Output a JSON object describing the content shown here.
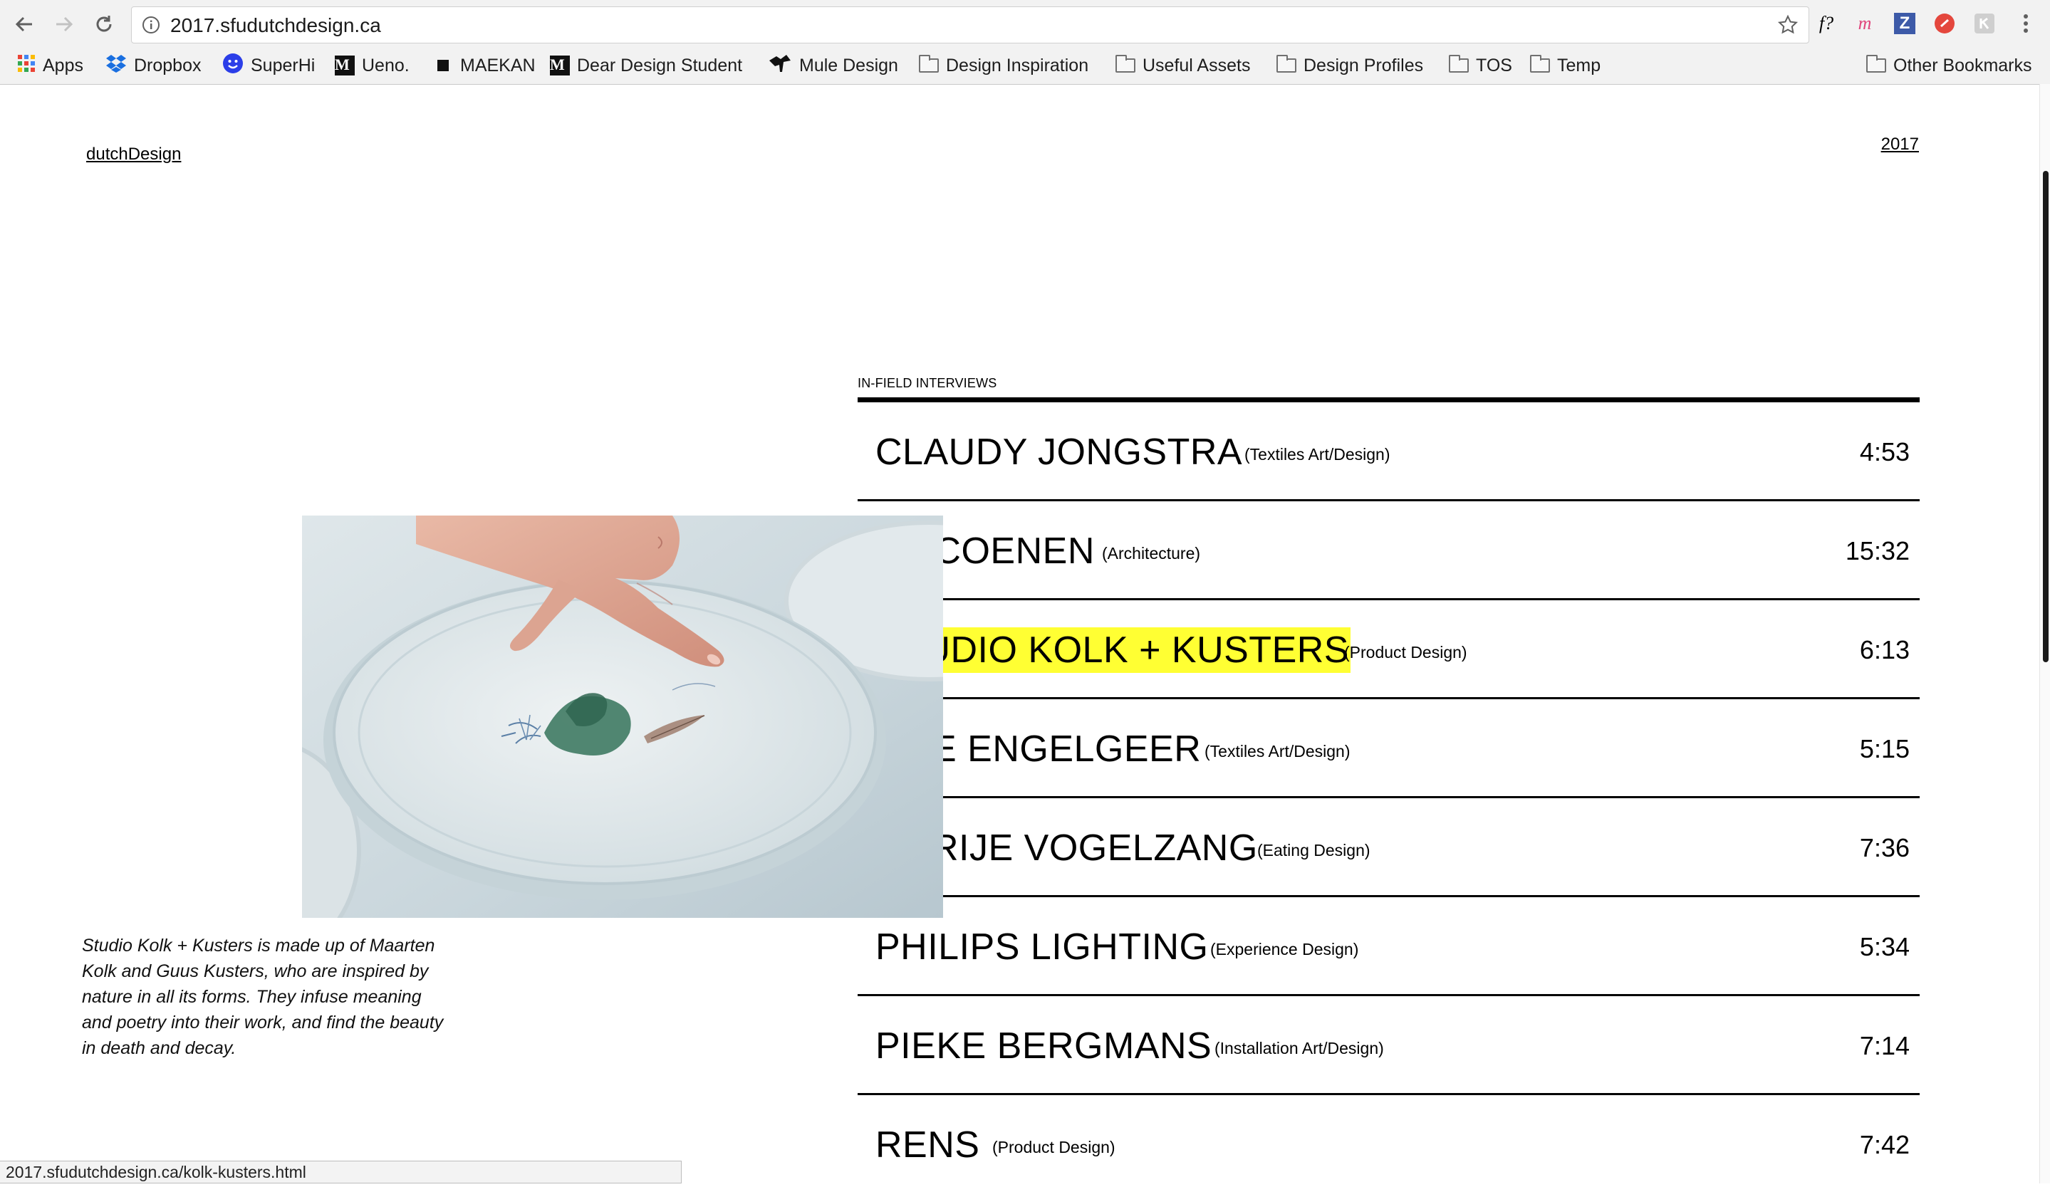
{
  "browser": {
    "url": "2017.sfudutchdesign.ca",
    "bookmarks": [
      {
        "label": "Apps",
        "icon": "apps-grid-icon"
      },
      {
        "label": "Dropbox",
        "icon": "dropbox-icon"
      },
      {
        "label": "SuperHi",
        "icon": "superhi-icon"
      },
      {
        "label": "Ueno.",
        "icon": "medium-icon"
      },
      {
        "label": "MAEKAN",
        "icon": "maekan-icon"
      },
      {
        "label": "Dear Design Student",
        "icon": "medium-icon"
      },
      {
        "label": "Mule Design",
        "icon": "mule-icon"
      },
      {
        "label": "Design Inspiration",
        "icon": "folder-icon"
      },
      {
        "label": "Useful Assets",
        "icon": "folder-icon"
      },
      {
        "label": "Design Profiles",
        "icon": "folder-icon"
      },
      {
        "label": "TOS",
        "icon": "folder-icon"
      },
      {
        "label": "Temp",
        "icon": "folder-icon"
      }
    ],
    "other_bookmarks": "Other Bookmarks",
    "extensions": [
      "f?",
      "m",
      "Z"
    ],
    "status_url": "2017.sfudutchdesign.ca/kolk-kusters.html"
  },
  "site": {
    "logo": "dutchDesign",
    "year": "2017"
  },
  "section": {
    "label": "IN-FIELD INTERVIEWS",
    "highlight_color": "#ffff33"
  },
  "interviews": [
    {
      "name": "CLAUDY JONGSTRA",
      "category": "(Textiles Art/Design)",
      "duration": "4:53",
      "highlighted": false
    },
    {
      "name": "JO COENEN",
      "category": "(Architecture)",
      "duration": "15:32",
      "highlighted": false
    },
    {
      "name": "STUDIO KOLK + KUSTERS",
      "category": "(Product Design)",
      "duration": "6:13",
      "highlighted": true
    },
    {
      "name": "MAE ENGELGEER",
      "category": "(Textiles Art/Design)",
      "duration": "5:15",
      "highlighted": false
    },
    {
      "name": "MARIJE VOGELZANG",
      "category": "(Eating Design)",
      "duration": "7:36",
      "highlighted": false
    },
    {
      "name": "PHILIPS LIGHTING",
      "category": "(Experience Design)",
      "duration": "5:34",
      "highlighted": false
    },
    {
      "name": "PIEKE BERGMANS",
      "category": "(Installation Art/Design)",
      "duration": "7:14",
      "highlighted": false
    },
    {
      "name": "RENS",
      "category": "(Product Design)",
      "duration": "7:42",
      "highlighted": false
    }
  ],
  "preview": {
    "caption": "Studio Kolk + Kusters is made up of Maarten Kolk and Guus Kusters, who are inspired by nature in all its forms. They infuse meaning and poetry into their work, and find the beauty in death and decay."
  }
}
